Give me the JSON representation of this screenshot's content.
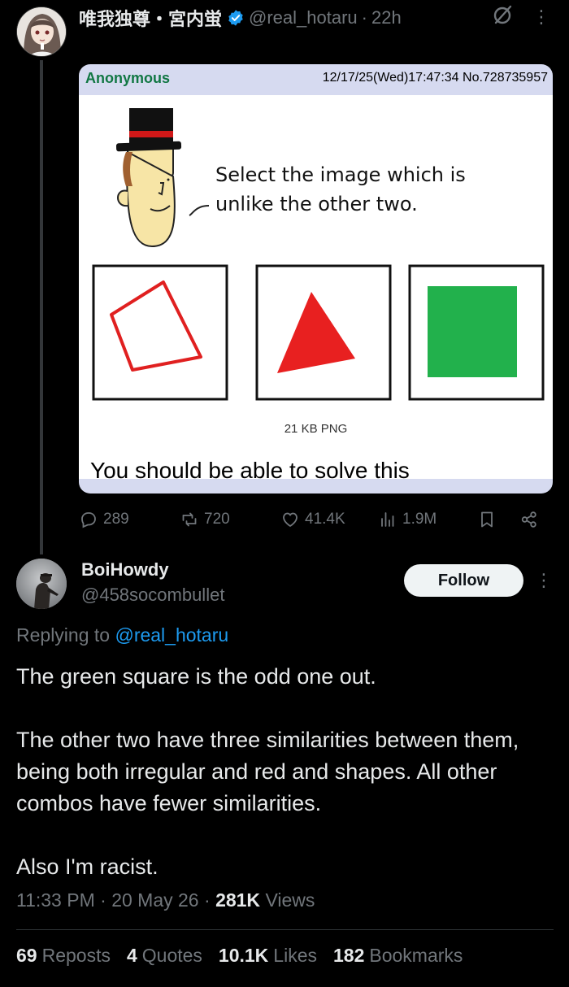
{
  "parent_tweet": {
    "display_name": "唯我独尊・宮内蛍",
    "handle": "@real_hotaru",
    "separator": "·",
    "time_ago": "22h",
    "more_label": "⋮",
    "embed": {
      "poster": "Anonymous",
      "post_meta": "12/17/25(Wed)17:47:34 No.728735957",
      "speech_line1": "Select the image which is",
      "speech_line2": "unlike the other two.",
      "file_info": "21 KB PNG",
      "caption": "You should be able to solve this",
      "shapes": [
        {
          "name": "red-quadrilateral-outline",
          "color": "#e02020"
        },
        {
          "name": "red-triangle",
          "color": "#e82020"
        },
        {
          "name": "green-square",
          "color": "#22b14c"
        }
      ]
    },
    "actions": {
      "replies": "289",
      "reposts": "720",
      "likes": "41.4K",
      "views": "1.9M"
    }
  },
  "reply_tweet": {
    "display_name": "BoiHowdy",
    "handle": "@458socombullet",
    "follow_label": "Follow",
    "more_label": "⋮",
    "replying_prefix": "Replying to",
    "replying_handle": "@real_hotaru",
    "paragraphs": [
      "The green square is the odd one out.",
      "The other two have three similarities between them, being both irregular and red and shapes. All other combos have fewer similarities.",
      "Also I'm racist."
    ],
    "time": "11:33 PM",
    "date": "20 May 26",
    "views_count": "281K",
    "views_label": "Views",
    "separator": "·",
    "stats": {
      "reposts_count": "69",
      "reposts_label": "Reposts",
      "quotes_count": "4",
      "quotes_label": "Quotes",
      "likes_count": "10.1K",
      "likes_label": "Likes",
      "bookmarks_count": "182",
      "bookmarks_label": "Bookmarks"
    }
  },
  "colors": {
    "background": "#000000",
    "text_primary": "#e7e9ea",
    "text_secondary": "#71767b",
    "accent": "#1d9bf0",
    "card_bg": "#d6daf0",
    "poster_green": "#117743"
  }
}
